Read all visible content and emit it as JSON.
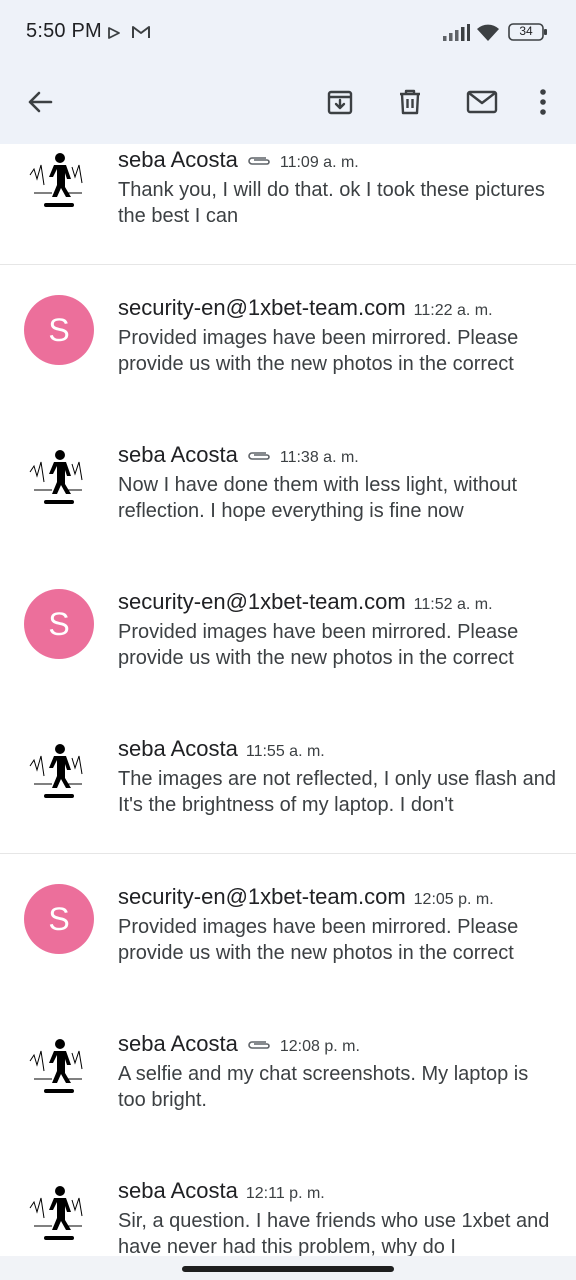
{
  "status": {
    "time": "5:50 PM",
    "battery": "34",
    "icons": [
      "play-store-icon",
      "gmail-icon",
      "signal-icon",
      "wifi-icon",
      "battery-icon"
    ]
  },
  "toolbar": {
    "icons": [
      "back-arrow-icon",
      "archive-icon",
      "delete-icon",
      "mark-unread-icon",
      "more-vert-icon"
    ]
  },
  "colors": {
    "header_bg": "#eef2f9",
    "avatar_pink": "#ec6f9b"
  },
  "messages": [
    {
      "sender": "seba Acosta",
      "time": "11:09 a. m.",
      "attachment": true,
      "avatar": "photo",
      "snippet": "Thank you, I will do that. ok I took these pictures the best I can"
    },
    {
      "sender": "security-en@1xbet-team.com",
      "time": "11:22 a. m.",
      "attachment": false,
      "avatar": "S",
      "snippet": "Provided images have been mirrored. Please provide us with the new photos in the correct"
    },
    {
      "sender": "seba Acosta",
      "time": "11:38 a. m.",
      "attachment": true,
      "avatar": "photo",
      "snippet": "Now I have done them with less light, without reflection. I hope everything is fine now"
    },
    {
      "sender": "security-en@1xbet-team.com",
      "time": "11:52 a. m.",
      "attachment": false,
      "avatar": "S",
      "snippet": "Provided images have been mirrored. Please provide us with the new photos in the correct"
    },
    {
      "sender": "seba Acosta",
      "time": "11:55 a. m.",
      "attachment": false,
      "avatar": "photo",
      "snippet": "The images are not reflected, I only use flash and It's the brightness of my laptop. I don't"
    },
    {
      "sender": "security-en@1xbet-team.com",
      "time": "12:05 p. m.",
      "attachment": false,
      "avatar": "S",
      "snippet": "Provided images have been mirrored. Please provide us with the new photos in the correct"
    },
    {
      "sender": "seba Acosta",
      "time": "12:08 p. m.",
      "attachment": true,
      "avatar": "photo",
      "snippet": "A selfie and my chat screenshots. My laptop is too bright."
    },
    {
      "sender": "seba Acosta",
      "time": "12:11 p. m.",
      "attachment": false,
      "avatar": "photo",
      "snippet": "Sir, a question. I have friends who use 1xbet and have never had this problem, why do I"
    }
  ]
}
